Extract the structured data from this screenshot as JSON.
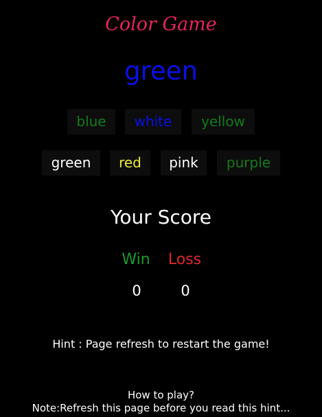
{
  "game": {
    "title": "Color Game",
    "target_word": "green"
  },
  "options_row1": [
    {
      "label": "blue",
      "color": "#157a1b"
    },
    {
      "label": "white",
      "color": "#0a10e6"
    },
    {
      "label": "yellow",
      "color": "#157a1b"
    }
  ],
  "options_row2": [
    {
      "label": "green",
      "color": "#ffffff"
    },
    {
      "label": "red",
      "color": "#ecec3a"
    },
    {
      "label": "pink",
      "color": "#ffffff"
    },
    {
      "label": "purple",
      "color": "#157a1b"
    }
  ],
  "score": {
    "title": "Your Score",
    "win_label": "Win",
    "loss_label": "Loss",
    "win_value": "0",
    "loss_value": "0"
  },
  "hint": "Hint : Page refresh to restart the game!",
  "how_to_play": {
    "title": "How to play?",
    "note": "Note:Refresh this page before you read this hint..."
  },
  "colors": {
    "background": "#000000",
    "title": "#e8245a",
    "target": "#0a10e6",
    "win": "#1c9c2a",
    "loss": "#e02a2a",
    "option_bg": "#0d0d0d"
  }
}
